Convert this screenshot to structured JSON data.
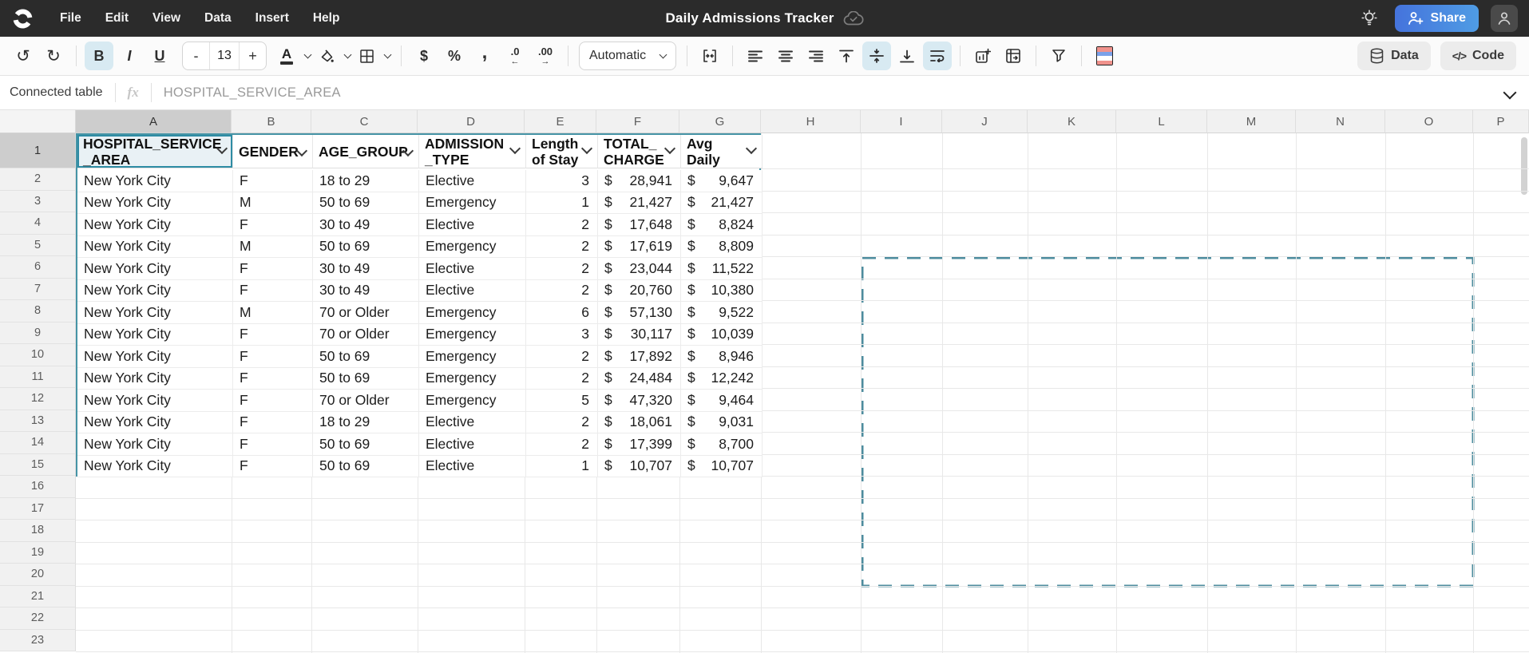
{
  "colors": {
    "topbar_bg": "#2b2b2b",
    "accent_teal": "#4694a6",
    "selection_border": "#2e8ca4",
    "selection_fill": "#e9f1f5",
    "dashed_range": "#4d8c9e",
    "active_tool_bg": "#d8eaf2",
    "share_gradient_start": "#4573dc",
    "share_gradient_end": "#4f9ce4"
  },
  "top_bar": {
    "menus": [
      "File",
      "Edit",
      "View",
      "Data",
      "Insert",
      "Help"
    ],
    "title": "Daily Admissions Tracker",
    "share_label": "Share"
  },
  "toolbar": {
    "undo_glyph": "↺",
    "redo_glyph": "↻",
    "bold_label": "B",
    "italic_label": "I",
    "underline_label": "U",
    "font_size_decrease": "-",
    "font_size": "13",
    "font_size_increase": "+",
    "text_color_letter": "A",
    "currency_label": "$",
    "percent_label": "%",
    "comma_label": ",",
    "decrease_decimal_label": ".0",
    "decrease_decimal_arrow": "←",
    "increase_decimal_label": ".00",
    "increase_decimal_arrow": "→",
    "number_format_value": "Automatic",
    "data_button_label": "Data",
    "code_button_label": "Code",
    "code_glyph": "</>"
  },
  "formula_bar": {
    "context_label": "Connected table",
    "fx_label": "fx",
    "value": "HOSPITAL_SERVICE_AREA"
  },
  "grid": {
    "column_letters": [
      "A",
      "B",
      "C",
      "D",
      "E",
      "F",
      "G",
      "H",
      "I",
      "J",
      "K",
      "L",
      "M",
      "N",
      "O",
      "P"
    ],
    "row_numbers": [
      "1",
      "2",
      "3",
      "4",
      "5",
      "6",
      "7",
      "8",
      "9",
      "10",
      "11",
      "12",
      "13",
      "14",
      "15",
      "16",
      "17",
      "18",
      "19",
      "20",
      "21",
      "22",
      "23"
    ],
    "table": {
      "currency_symbol": "$",
      "headers": [
        {
          "label": "HOSPITAL_SERVICE_AREA",
          "lines": [
            "HOSPITAL_SERVICE",
            "_AREA"
          ],
          "selected": true
        },
        {
          "label": "GENDER",
          "lines": [
            "GENDER"
          ]
        },
        {
          "label": "AGE_GROUP",
          "lines": [
            "AGE_GROUP"
          ]
        },
        {
          "label": "ADMISSION_TYPE",
          "lines": [
            "ADMISSION",
            "_TYPE"
          ]
        },
        {
          "label": "Length of Stay",
          "lines": [
            "Length",
            "of Stay"
          ]
        },
        {
          "label": "TOTAL_CHARGE",
          "lines": [
            "TOTAL_",
            "CHARGE"
          ]
        },
        {
          "label": "Avg Daily",
          "lines": [
            "Avg",
            "Daily"
          ]
        }
      ],
      "rows": [
        [
          "New York City",
          "F",
          "18 to 29",
          "Elective",
          "3",
          "28,941",
          "9,647"
        ],
        [
          "New York City",
          "M",
          "50 to 69",
          "Emergency",
          "1",
          "21,427",
          "21,427"
        ],
        [
          "New York City",
          "F",
          "30 to 49",
          "Elective",
          "2",
          "17,648",
          "8,824"
        ],
        [
          "New York City",
          "M",
          "50 to 69",
          "Emergency",
          "2",
          "17,619",
          "8,809"
        ],
        [
          "New York City",
          "F",
          "30 to 49",
          "Elective",
          "2",
          "23,044",
          "11,522"
        ],
        [
          "New York City",
          "F",
          "30 to 49",
          "Elective",
          "2",
          "20,760",
          "10,380"
        ],
        [
          "New York City",
          "M",
          "70 or Older",
          "Emergency",
          "6",
          "57,130",
          "9,522"
        ],
        [
          "New York City",
          "F",
          "70 or Older",
          "Emergency",
          "3",
          "30,117",
          "10,039"
        ],
        [
          "New York City",
          "F",
          "50 to 69",
          "Emergency",
          "2",
          "17,892",
          "8,946"
        ],
        [
          "New York City",
          "F",
          "50 to 69",
          "Emergency",
          "2",
          "24,484",
          "12,242"
        ],
        [
          "New York City",
          "F",
          "70 or Older",
          "Emergency",
          "5",
          "47,320",
          "9,464"
        ],
        [
          "New York City",
          "F",
          "18 to 29",
          "Elective",
          "2",
          "18,061",
          "9,031"
        ],
        [
          "New York City",
          "F",
          "50 to 69",
          "Elective",
          "2",
          "17,399",
          "8,700"
        ],
        [
          "New York City",
          "F",
          "50 to 69",
          "Elective",
          "1",
          "10,707",
          "10,707"
        ]
      ]
    }
  }
}
